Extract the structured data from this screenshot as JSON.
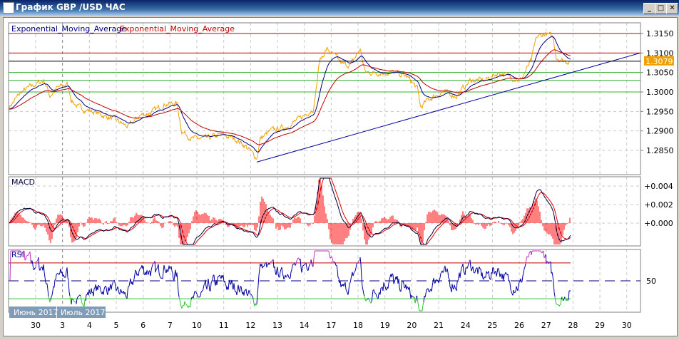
{
  "window": {
    "title": "График GBP /USD  ЧАС",
    "minimize": "_",
    "maximize": "□",
    "close": "✕"
  },
  "colors": {
    "price": "#f0a000",
    "ema_fast": "#000080",
    "ema_slow": "#c00000",
    "macd_line": "#000040",
    "signal_line": "#e00000",
    "hist": "#ff0000",
    "rsi": "#0000a0",
    "rsi_over": "#c030c0",
    "rsi_under": "#30c030",
    "trend": "#0000a0",
    "level_red": "#c00000",
    "level_green": "#30b030",
    "last": "#000000",
    "badge": "#f0a000"
  },
  "chart_data": {
    "type": "line",
    "title": "GBP/USD H1",
    "legend": [
      {
        "label": "Exponential_Moving_Average",
        "color": "#000080"
      },
      {
        "label": "Exponential_Moving_Average",
        "color": "#c00000"
      }
    ],
    "x_unit": "trading day index (0 = 30 June 2017)",
    "x_ticks": [
      {
        "d": 0,
        "label": "30"
      },
      {
        "d": 1,
        "label": "3"
      },
      {
        "d": 2,
        "label": "4"
      },
      {
        "d": 3,
        "label": "5"
      },
      {
        "d": 4,
        "label": "6"
      },
      {
        "d": 5,
        "label": "7"
      },
      {
        "d": 6,
        "label": "10"
      },
      {
        "d": 7,
        "label": "11"
      },
      {
        "d": 8,
        "label": "12"
      },
      {
        "d": 9,
        "label": "13"
      },
      {
        "d": 10,
        "label": "14"
      },
      {
        "d": 11,
        "label": "17"
      },
      {
        "d": 12,
        "label": "18"
      },
      {
        "d": 13,
        "label": "19"
      },
      {
        "d": 14,
        "label": "20"
      },
      {
        "d": 15,
        "label": "21"
      },
      {
        "d": 16,
        "label": "24"
      },
      {
        "d": 17,
        "label": "25"
      },
      {
        "d": 18,
        "label": "26"
      },
      {
        "d": 19,
        "label": "27"
      },
      {
        "d": 20,
        "label": "28"
      },
      {
        "d": 21,
        "label": "29"
      },
      {
        "d": 22,
        "label": "30"
      }
    ],
    "month_labels": [
      "Июнь 2017",
      "Июль 2017"
    ],
    "xlim": [
      -1,
      22.5
    ],
    "price": {
      "ylim": [
        1.28,
        1.318
      ],
      "y_ticks": [
        "1.3150",
        "1.3100",
        "1.3050",
        "1.3000",
        "1.2950",
        "1.2900",
        "1.2850"
      ],
      "y_tick_values": [
        1.315,
        1.31,
        1.305,
        1.3,
        1.295,
        1.29,
        1.285
      ],
      "last_price": "1.3079",
      "last_value": 1.3079,
      "levels_red": [
        1.315,
        1.31
      ],
      "levels_green": [
        1.305,
        1.303,
        1.3
      ],
      "trendline": [
        [
          8.23,
          1.282
        ],
        [
          22.5,
          1.31
        ]
      ],
      "path": [
        [
          -1.0,
          1.296
        ],
        [
          -0.53,
          1.3
        ],
        [
          0,
          1.302
        ],
        [
          0.32,
          1.303
        ],
        [
          0.53,
          1.299
        ],
        [
          0.8,
          1.301
        ],
        [
          1.19,
          1.302
        ],
        [
          1.33,
          1.298
        ],
        [
          1.59,
          1.296
        ],
        [
          2.12,
          1.295
        ],
        [
          2.92,
          1.293
        ],
        [
          3.45,
          1.291
        ],
        [
          3.88,
          1.294
        ],
        [
          4.38,
          1.295
        ],
        [
          4.83,
          1.297
        ],
        [
          5.26,
          1.297
        ],
        [
          5.44,
          1.29
        ],
        [
          5.84,
          1.288
        ],
        [
          6.37,
          1.288
        ],
        [
          6.9,
          1.289
        ],
        [
          7.43,
          1.288
        ],
        [
          7.83,
          1.286
        ],
        [
          8.23,
          1.283
        ],
        [
          8.36,
          1.288
        ],
        [
          8.76,
          1.29
        ],
        [
          9.29,
          1.291
        ],
        [
          9.82,
          1.293
        ],
        [
          10.35,
          1.296
        ],
        [
          10.57,
          1.308
        ],
        [
          10.83,
          1.311
        ],
        [
          11.15,
          1.309
        ],
        [
          11.42,
          1.307
        ],
        [
          11.73,
          1.307
        ],
        [
          12.08,
          1.311
        ],
        [
          12.26,
          1.305
        ],
        [
          12.74,
          1.305
        ],
        [
          13.27,
          1.305
        ],
        [
          13.8,
          1.304
        ],
        [
          14.2,
          1.301
        ],
        [
          14.33,
          1.296
        ],
        [
          14.6,
          1.298
        ],
        [
          15.13,
          1.3
        ],
        [
          15.66,
          1.299
        ],
        [
          16.19,
          1.303
        ],
        [
          16.72,
          1.303
        ],
        [
          17.26,
          1.305
        ],
        [
          17.65,
          1.304
        ],
        [
          18.05,
          1.303
        ],
        [
          18.45,
          1.308
        ],
        [
          18.64,
          1.314
        ],
        [
          18.98,
          1.315
        ],
        [
          19.25,
          1.314
        ],
        [
          19.38,
          1.309
        ],
        [
          19.64,
          1.308
        ],
        [
          19.91,
          1.3079
        ]
      ]
    },
    "macd": {
      "label": "MACD",
      "ylim": [
        -0.0025,
        0.0048
      ],
      "y_ticks": [
        "+0.004",
        "+0.002",
        "+0.000"
      ],
      "y_tick_values": [
        0.004,
        0.002,
        0
      ]
    },
    "rsi": {
      "label": "RSI",
      "ylim": [
        15,
        85
      ],
      "levels": [
        70,
        50,
        30
      ],
      "y_ticks": [
        "50"
      ],
      "y_tick_values": [
        50
      ]
    }
  }
}
